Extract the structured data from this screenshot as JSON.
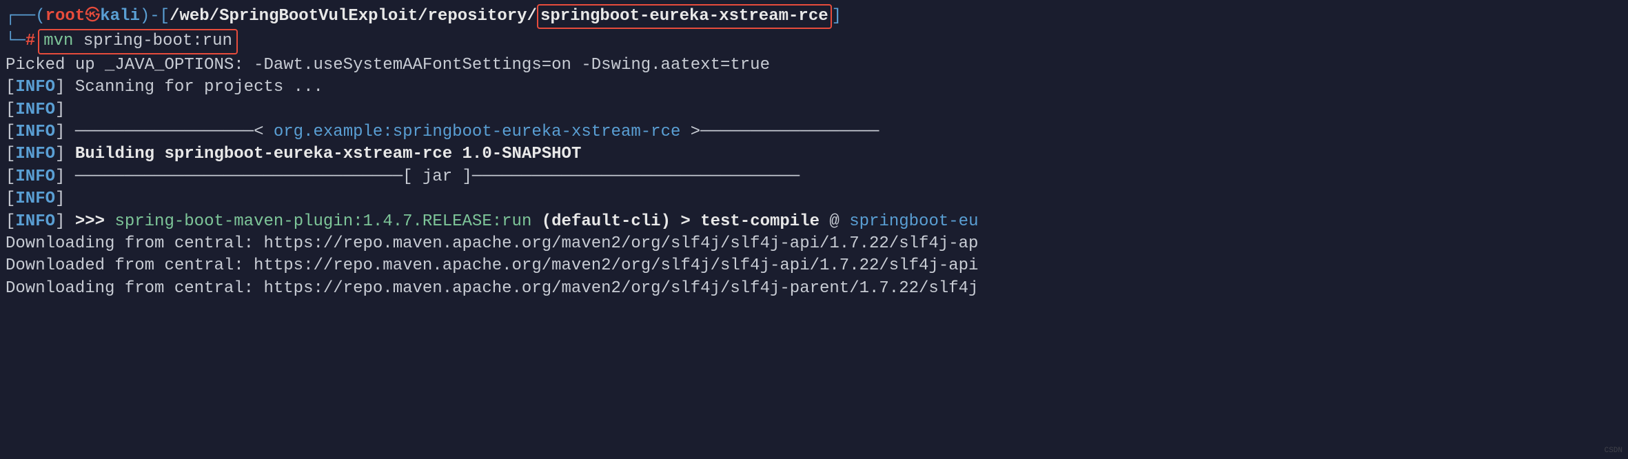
{
  "prompt": {
    "branch_prefix": "┌──(",
    "user": "root",
    "skull": "㉿",
    "host": "kali",
    "paren_close": ")",
    "dash": "-",
    "bracket_open": "[",
    "path_prefix": "/web/SpringBootVulExploit/repository/",
    "folder": "springboot-eureka-xstream-rce",
    "bracket_close": "]",
    "line2_prefix": "└─",
    "hash": "#",
    "cmd_mvn": "mvn",
    "cmd_args": " spring-boot:run"
  },
  "output": {
    "line1": "Picked up _JAVA_OPTIONS: -Dawt.useSystemAAFontSettings=on -Dswing.aatext=true",
    "info_label": "INFO",
    "scanning": " Scanning for projects ...",
    "sep_left": " ──────────────────< ",
    "project": "org.example:springboot-eureka-xstream-rce",
    "sep_right": " >──────────────────",
    "building": "Building springboot-eureka-xstream-rce 1.0-SNAPSHOT",
    "jar_line": " ─────────────────────────────────[ jar ]─────────────────────────────────",
    "arrows": ">>>",
    "plugin": " spring-boot-maven-plugin:1.4.7.RELEASE:run ",
    "default_cli": "(default-cli) > test-compile",
    "at": " @ ",
    "project_short": "springboot-eu",
    "dl1": "Downloading from central: https://repo.maven.apache.org/maven2/org/slf4j/slf4j-api/1.7.22/slf4j-ap",
    "dl2": "Downloaded from central: https://repo.maven.apache.org/maven2/org/slf4j/slf4j-api/1.7.22/slf4j-api",
    "dl3": "Downloading from central: https://repo.maven.apache.org/maven2/org/slf4j/slf4j-parent/1.7.22/slf4j"
  },
  "watermark": "CSDN"
}
